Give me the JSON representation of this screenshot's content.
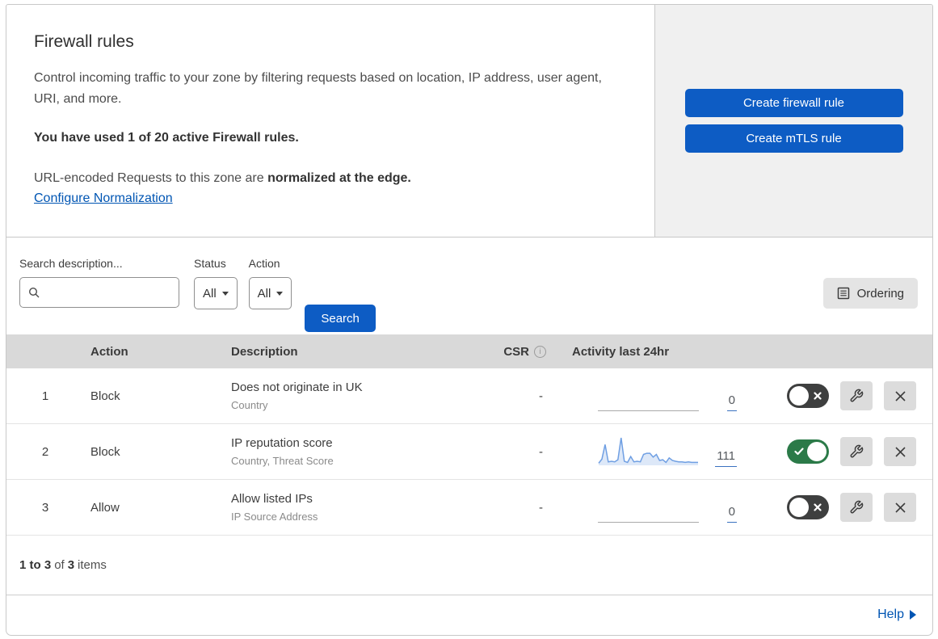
{
  "colors": {
    "primary_blue": "#0d5cc4",
    "link_blue": "#0055b3",
    "toggle_on_green": "#2b7a48",
    "toggle_off_gray": "#3e3f3f",
    "table_header_bg": "#d9d9d9",
    "panel_bg": "#f0f0f0",
    "sparkline_stroke": "#6f9fe3",
    "sparkline_fill": "#dde8f8"
  },
  "header": {
    "title": "Firewall rules",
    "description": "Control incoming traffic to your zone by filtering requests based on location, IP address, user agent, URI, and more.",
    "usage_text": "You have used 1 of 20 active Firewall rules.",
    "normalization_prefix": "URL-encoded Requests to this zone are ",
    "normalization_bold": "normalized at the edge.",
    "normalization_link": "Configure Normalization",
    "buttons": [
      {
        "label": "Create firewall rule"
      },
      {
        "label": "Create mTLS rule"
      }
    ]
  },
  "filters": {
    "search_label": "Search description...",
    "search_value": "",
    "status_label": "Status",
    "status_value": "All",
    "action_label": "Action",
    "action_value": "All",
    "search_button": "Search",
    "ordering_button": "Ordering"
  },
  "table": {
    "columns": {
      "action": "Action",
      "description": "Description",
      "csr": "CSR",
      "activity": "Activity last 24hr"
    },
    "rows": [
      {
        "index": "1",
        "action": "Block",
        "description": "Does not originate in UK",
        "fields": "Country",
        "csr": "-",
        "activity_count": "0",
        "enabled": false
      },
      {
        "index": "2",
        "action": "Block",
        "description": "IP reputation score",
        "fields": "Country, Threat Score",
        "csr": "-",
        "activity_count": "111",
        "enabled": true,
        "sparkline": [
          5,
          20,
          75,
          10,
          12,
          10,
          18,
          100,
          12,
          8,
          30,
          10,
          12,
          10,
          38,
          42,
          42,
          28,
          38,
          15,
          18,
          8,
          25,
          15,
          12,
          10,
          10,
          8,
          10,
          8,
          8,
          8
        ]
      },
      {
        "index": "3",
        "action": "Allow",
        "description": "Allow listed IPs",
        "fields": "IP Source Address",
        "csr": "-",
        "activity_count": "0",
        "enabled": false
      }
    ]
  },
  "footer": {
    "range": "1 to 3",
    "of": "of",
    "total": "3",
    "items": "items"
  },
  "help": {
    "label": "Help"
  }
}
